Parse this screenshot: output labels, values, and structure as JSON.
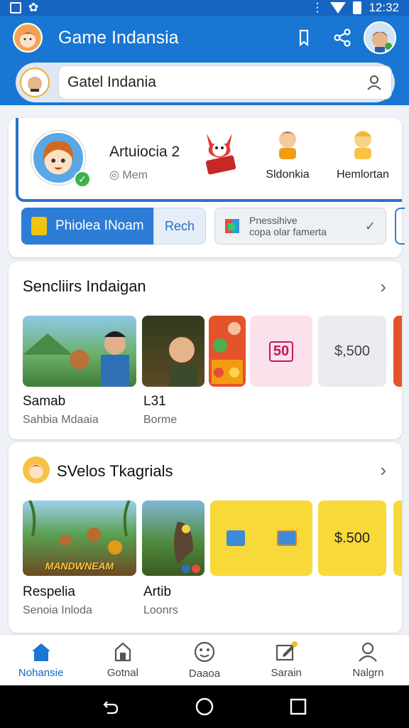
{
  "status": {
    "time": "12:32"
  },
  "app_bar": {
    "title": "Game Indansia"
  },
  "search": {
    "value": "Gatel Indania"
  },
  "profile": {
    "name": "Artuiocia 2",
    "sub": "Mem",
    "friends": [
      {
        "label": ""
      },
      {
        "label": "Sldonkia"
      },
      {
        "label": "Hemlortan"
      }
    ]
  },
  "chips": {
    "primary": "Phiolea INoam",
    "secondary": "Rech",
    "promo_line1": "Pnessihive",
    "promo_line2": "copa olar famerta"
  },
  "section1": {
    "title": "Sencliirs Indaigan",
    "items": [
      {
        "label": "Samab",
        "sub": "Sahbia Mdaaia"
      },
      {
        "label": "L31",
        "sub": "Borme"
      }
    ],
    "badge": "50",
    "price": "$,500"
  },
  "section2": {
    "title": "SVelos Tkagrials",
    "banner": "MANDWNEAM",
    "items": [
      {
        "label": "Respelia",
        "sub": "Senoia Inloda"
      },
      {
        "label": "Artib",
        "sub": "Loonrs"
      }
    ],
    "price": "$.500"
  },
  "nav": {
    "items": [
      {
        "label": "Nohansie",
        "icon": "home-icon"
      },
      {
        "label": "Gotnal",
        "icon": "store-icon"
      },
      {
        "label": "Daaoa",
        "icon": "smiley-icon"
      },
      {
        "label": "Sarain",
        "icon": "edit-icon"
      },
      {
        "label": "Nalgrn",
        "icon": "person-icon"
      }
    ]
  },
  "colors": {
    "primary": "#1976d2",
    "accent_yellow": "#f7d93a",
    "badge_pink": "#fbe1ec"
  }
}
